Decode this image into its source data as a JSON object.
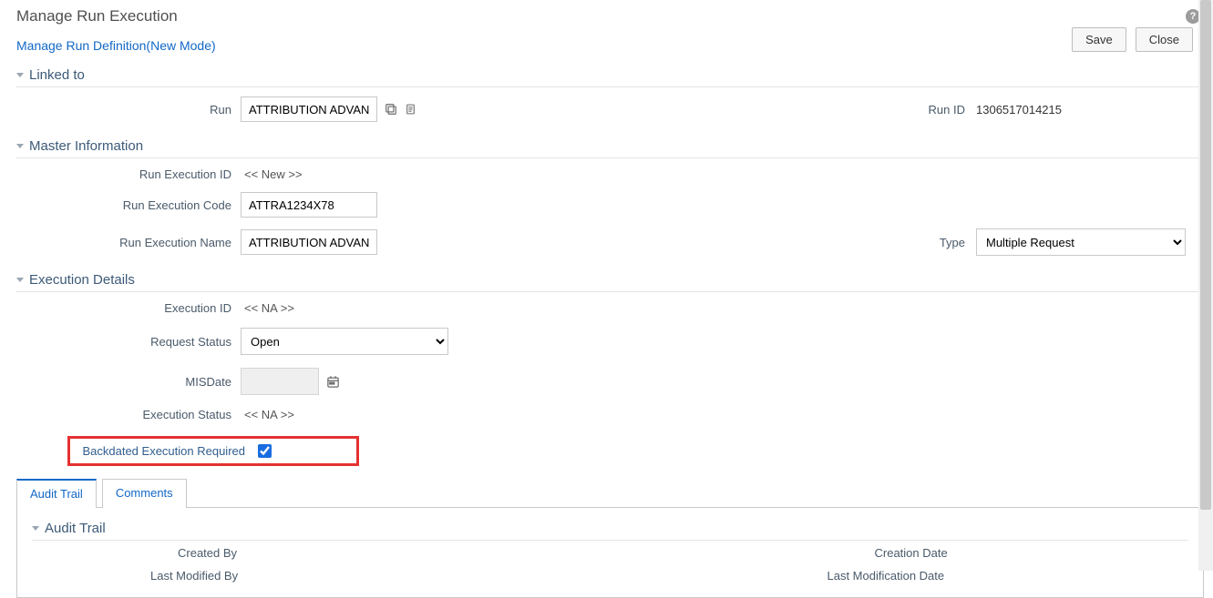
{
  "page": {
    "title": "Manage Run Execution",
    "subtitle_link": "Manage Run Definition(New Mode)"
  },
  "buttons": {
    "save": "Save",
    "close": "Close"
  },
  "sections": {
    "linked_to": "Linked to",
    "master_info": "Master Information",
    "exec_details": "Execution Details",
    "audit_trail": "Audit Trail"
  },
  "linked": {
    "run_label": "Run",
    "run_value": "ATTRIBUTION ADVANC",
    "run_id_label": "Run ID",
    "run_id_value": "1306517014215"
  },
  "master": {
    "exec_id_label": "Run Execution ID",
    "exec_id_value": "<< New >>",
    "exec_code_label": "Run Execution Code",
    "exec_code_value": "ATTRA1234X78",
    "exec_name_label": "Run Execution Name",
    "exec_name_value": "ATTRIBUTION ADVANCED APPROACH",
    "type_label": "Type",
    "type_value": "Multiple Request"
  },
  "exec": {
    "execution_id_label": "Execution ID",
    "execution_id_value": "<< NA >>",
    "request_status_label": "Request Status",
    "request_status_value": "Open",
    "misdate_label": "MISDate",
    "misdate_value": "",
    "execution_status_label": "Execution Status",
    "execution_status_value": "<< NA >>",
    "backdated_label": "Backdated Execution Required",
    "backdated_checked": true
  },
  "tabs": {
    "audit_trail": "Audit Trail",
    "comments": "Comments"
  },
  "audit": {
    "created_by_label": "Created By",
    "creation_date_label": "Creation Date",
    "last_modified_by_label": "Last Modified By",
    "last_modification_date_label": "Last Modification Date"
  }
}
